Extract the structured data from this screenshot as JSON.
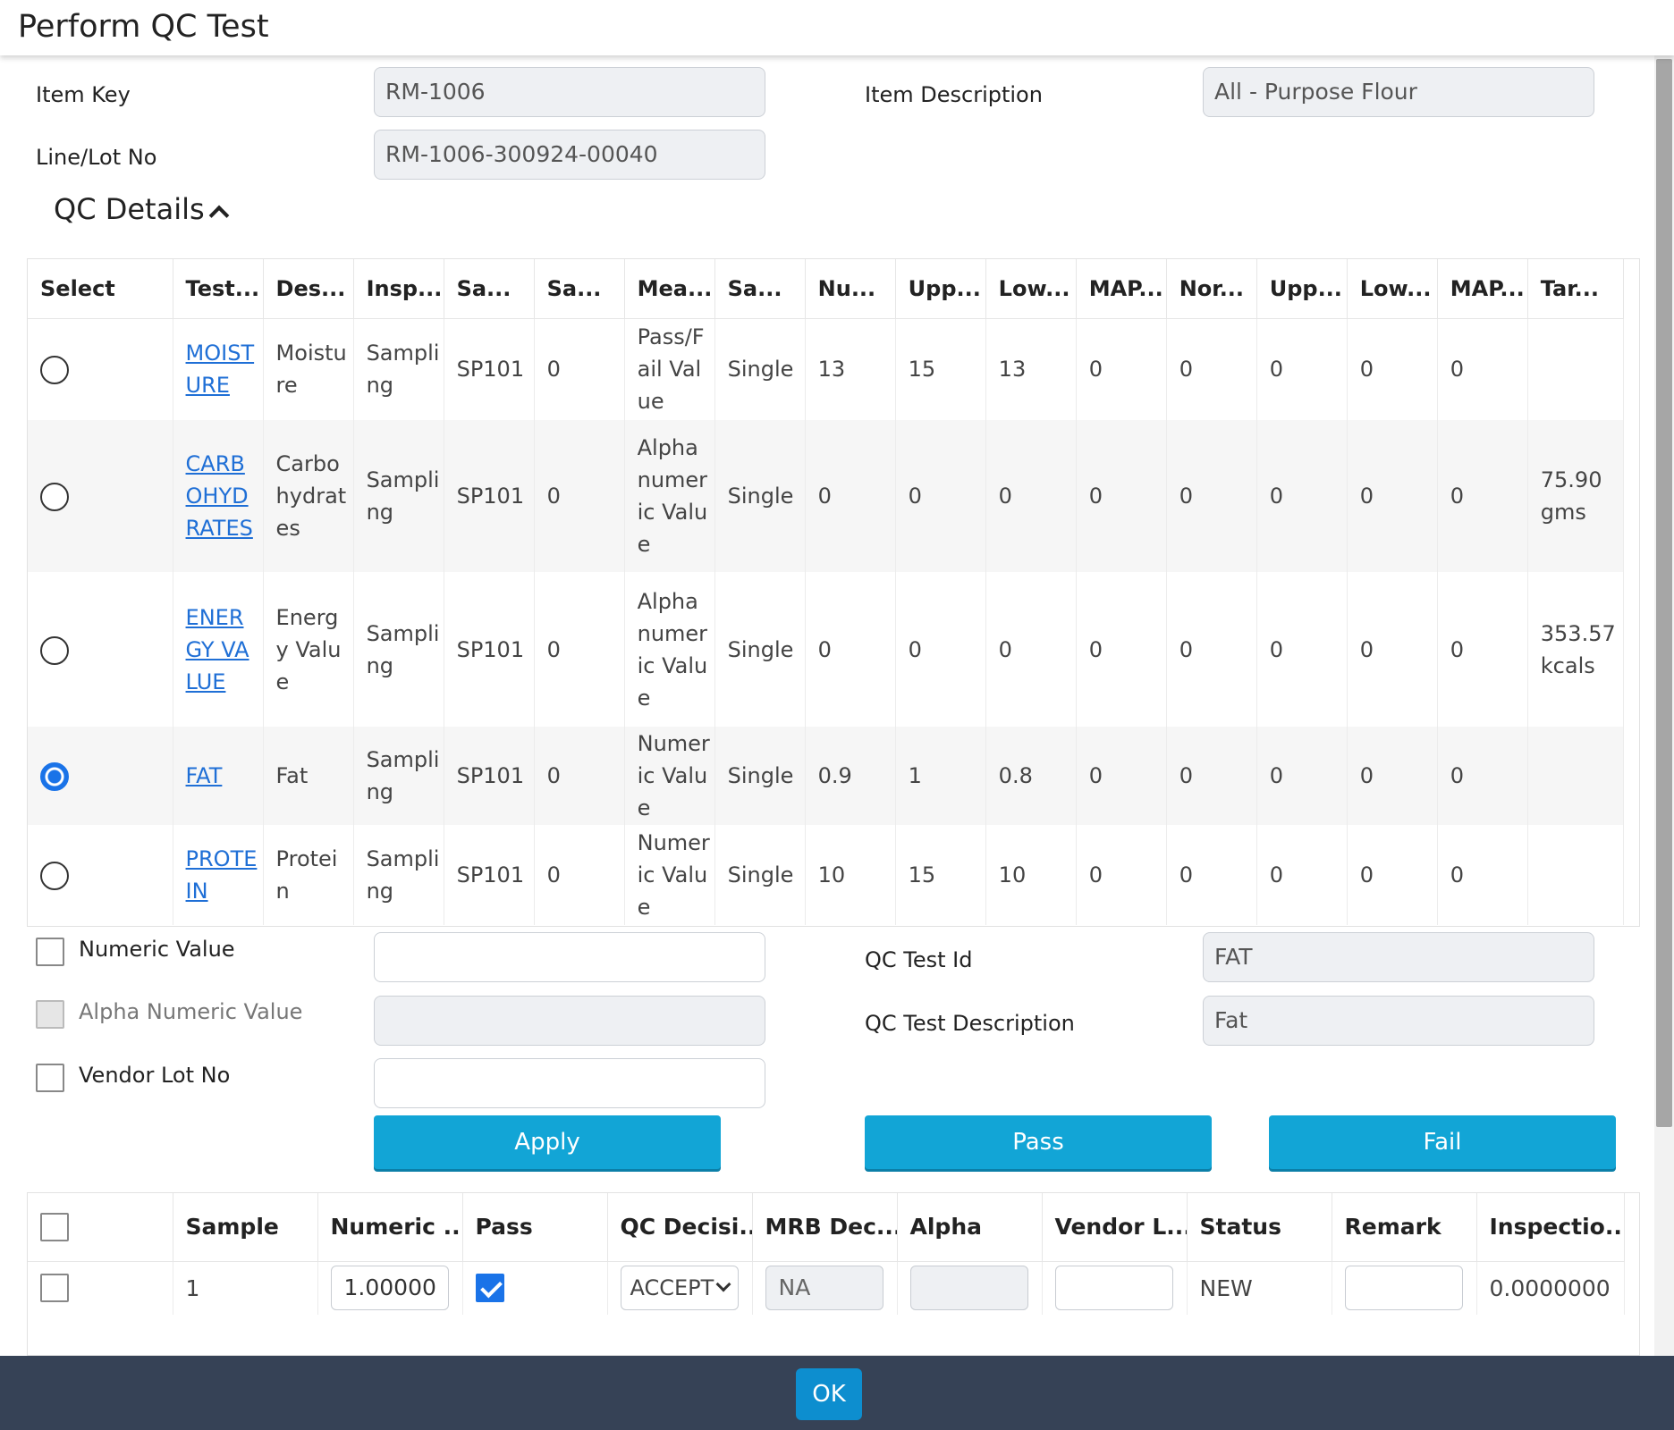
{
  "header": {
    "title": "Perform QC Test"
  },
  "form": {
    "item_key_label": "Item Key",
    "item_key_value": "RM-1006",
    "item_desc_label": "Item Description",
    "item_desc_value": "All - Purpose Flour",
    "lot_label": "Line/Lot No",
    "lot_value": "RM-1006-300924-00040"
  },
  "qc_section": {
    "title": "QC Details"
  },
  "qc_grid": {
    "headers": [
      "Select",
      "Test...",
      "Des...",
      "Insp...",
      "Sa...",
      "Sa...",
      "Mea...",
      "Sa...",
      "Nu...",
      "Upp...",
      "Low...",
      "MAP...",
      "Nor...",
      "Upp...",
      "Low...",
      "MAP...",
      "Tar..."
    ],
    "rows": [
      {
        "selected": false,
        "test": "MOISTURE",
        "desc": "Moisture",
        "insp": "Sampling",
        "sa1": "SP101",
        "sa2": "0",
        "mea": "Pass/Fail Value",
        "sa3": "Single",
        "nu": "13",
        "upp": "15",
        "low": "13",
        "map": "0",
        "nor": "0",
        "upp2": "0",
        "low2": "0",
        "map2": "0",
        "tar": ""
      },
      {
        "selected": false,
        "test": "CARBOHYDRATES",
        "desc": "Carbohydrates",
        "insp": "Sampling",
        "sa1": "SP101",
        "sa2": "0",
        "mea": "Alphanumeric Value",
        "sa3": "Single",
        "nu": "0",
        "upp": "0",
        "low": "0",
        "map": "0",
        "nor": "0",
        "upp2": "0",
        "low2": "0",
        "map2": "0",
        "tar": "75.90 gms"
      },
      {
        "selected": false,
        "test": "ENERGY VALUE",
        "desc": "Energy Value",
        "insp": "Sampling",
        "sa1": "SP101",
        "sa2": "0",
        "mea": "Alphanumeric Value",
        "sa3": "Single",
        "nu": "0",
        "upp": "0",
        "low": "0",
        "map": "0",
        "nor": "0",
        "upp2": "0",
        "low2": "0",
        "map2": "0",
        "tar": "353.57kcals"
      },
      {
        "selected": true,
        "test": "FAT",
        "desc": "Fat",
        "insp": "Sampling",
        "sa1": "SP101",
        "sa2": "0",
        "mea": "Numeric Value",
        "sa3": "Single",
        "nu": "0.9",
        "upp": "1",
        "low": "0.8",
        "map": "0",
        "nor": "0",
        "upp2": "0",
        "low2": "0",
        "map2": "0",
        "tar": ""
      },
      {
        "selected": false,
        "test": "PROTEIN",
        "desc": "Protein",
        "insp": "Sampling",
        "sa1": "SP101",
        "sa2": "0",
        "mea": "Numeric Value",
        "sa3": "Single",
        "nu": "10",
        "upp": "15",
        "low": "10",
        "map": "0",
        "nor": "0",
        "upp2": "0",
        "low2": "0",
        "map2": "0",
        "tar": ""
      }
    ]
  },
  "entry": {
    "numeric_label": "Numeric Value",
    "numeric_value": "",
    "alpha_label": "Alpha Numeric Value",
    "alpha_value": "",
    "vendor_lot_label": "Vendor Lot No",
    "vendor_lot_value": "",
    "qc_test_id_label": "QC Test Id",
    "qc_test_id_value": "FAT",
    "qc_test_desc_label": "QC Test Description",
    "qc_test_desc_value": "Fat"
  },
  "buttons": {
    "apply": "Apply",
    "pass": "Pass",
    "fail": "Fail",
    "ok": "OK"
  },
  "sample_grid": {
    "headers": [
      "",
      "Sample",
      "Numeric ...",
      "Pass",
      "QC Decisi...",
      "MRB Dec...",
      "Alpha",
      "Vendor L...",
      "Status",
      "Remark",
      "Inspectio..."
    ],
    "rows": [
      {
        "selected": false,
        "sample": "1",
        "numeric": "1.00000",
        "pass": true,
        "qc_decision": "ACCEPT",
        "mrb_decision": "NA",
        "alpha": "",
        "vendor_lot": "",
        "status": "NEW",
        "remark": "",
        "inspection": "0.0000000"
      }
    ]
  },
  "colors": {
    "accent": "#12a5d6",
    "link": "#1f6fd6",
    "footer": "#364256",
    "ok_button": "#0d8ecf"
  }
}
